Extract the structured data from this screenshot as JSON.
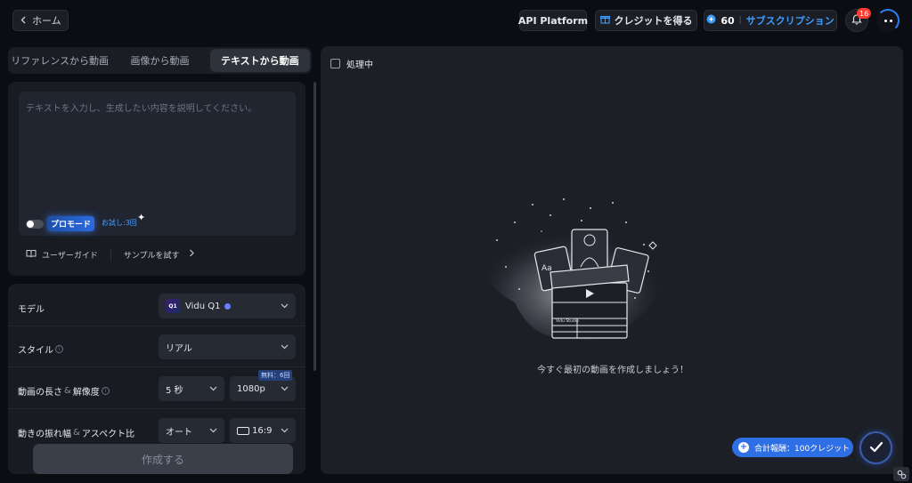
{
  "topbar": {
    "home_label": "ホーム",
    "api_label": "API Platform",
    "credit_label": "クレジットを得る",
    "credits": "60",
    "sub_label": "サブスクリプション",
    "notification_count": "16"
  },
  "tabs": [
    {
      "label": "リファレンスから動画"
    },
    {
      "label": "画像から動画"
    },
    {
      "label": "テキストから動画"
    }
  ],
  "prompt": {
    "placeholder": "テキストを入力し、生成したい内容を説明してください。",
    "pro_mode_label": "プロモード",
    "trial_label": "お試し:3回",
    "guide_label": "ユーザーガイド",
    "sample_label": "サンプルを試す"
  },
  "settings": {
    "model_label": "モデル",
    "model_value": "Vidu Q1",
    "model_icon_text": "Q1",
    "style_label": "スタイル",
    "style_value": "リアル",
    "duration_label_a": "動画の長さ",
    "duration_label_amp": "&",
    "duration_label_b": "解像度",
    "duration_value": "5 秒",
    "resolution_value": "1080p",
    "free_badge": "無料：6回",
    "motion_label_a": "動きの振れ幅",
    "motion_label_amp": "&",
    "motion_label_b": "アスペクト比",
    "motion_value": "オート",
    "aspect_value": "16:9"
  },
  "create_label": "作成する",
  "right": {
    "processing_label": "処理中",
    "empty_text": "今すぐ最初の動画を作成しましょう！",
    "illustration_text_aa": "Aa",
    "illustration_text_brand": "Vidu Studio"
  },
  "total_label": "合計報酬：100クレジット"
}
